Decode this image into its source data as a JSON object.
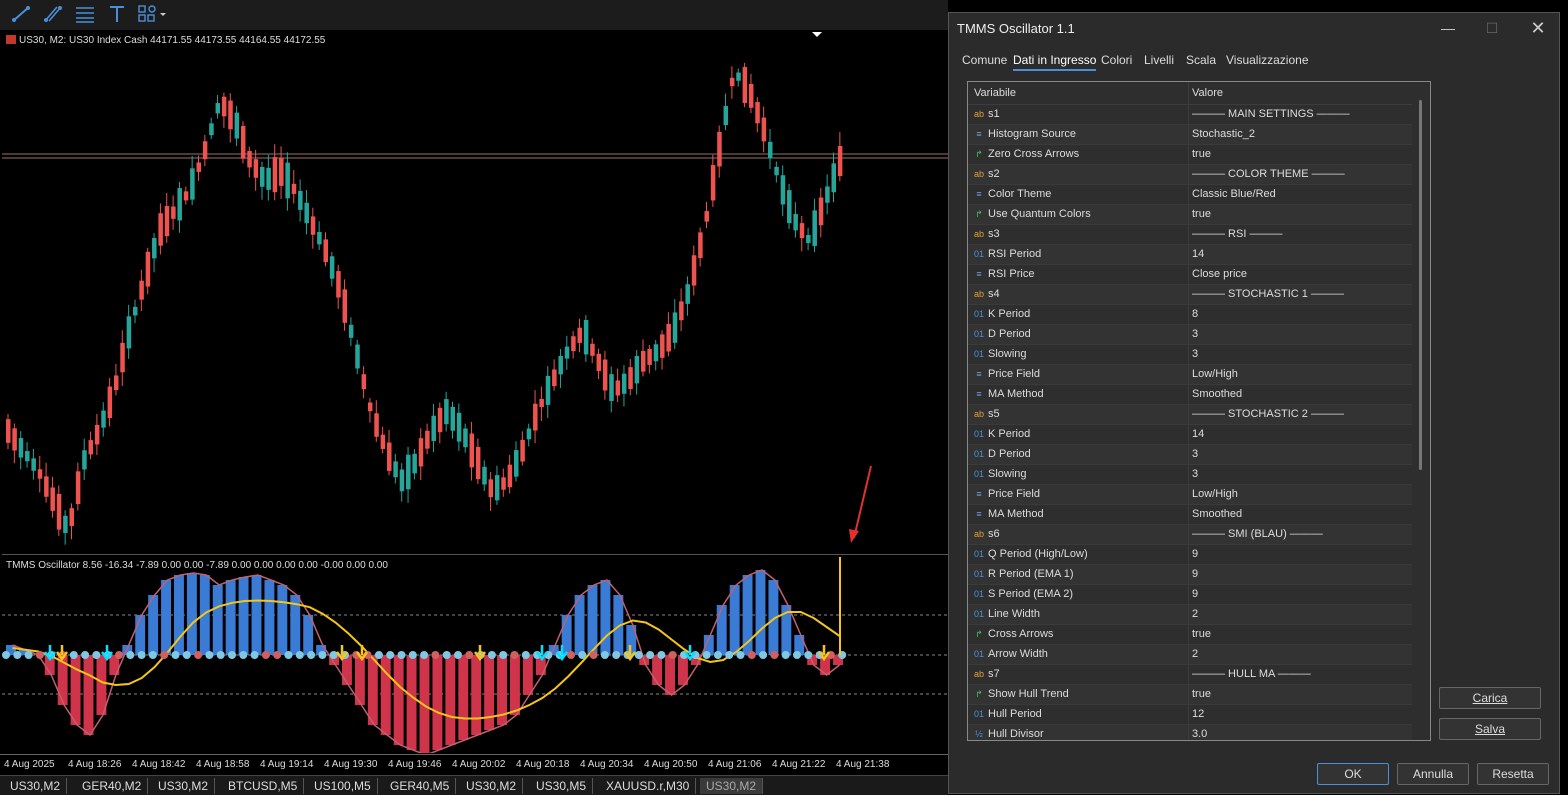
{
  "toolbar": {
    "icons": [
      "trendline-icon",
      "channel-icon",
      "fibonacci-icon",
      "text-icon",
      "shapes-icon"
    ]
  },
  "chart": {
    "info": "US30, M2:  US30 Index Cash  44171.55 44173.55 44164.55 44172.55",
    "osc_info": "TMMS Oscillator  8.56 -16.34 -7.89 0.00 0.00 -7.89 0.00 0.00 0.00 0.00 -0.00 0.00 0.00",
    "time_labels": [
      "4 Aug 2025",
      "4 Aug 18:26",
      "4 Aug 18:42",
      "4 Aug 18:58",
      "4 Aug 19:14",
      "4 Aug 19:30",
      "4 Aug 19:46",
      "4 Aug 20:02",
      "4 Aug 20:18",
      "4 Aug 20:34",
      "4 Aug 20:50",
      "4 Aug 21:06",
      "4 Aug 21:22",
      "4 Aug 21:38"
    ],
    "colors": {
      "bull": "#26a69a",
      "bear": "#ef5350",
      "hist_pos": "#3a7bd5",
      "hist_neg": "#d0344a",
      "ma_line": "#f5c518",
      "dots": "#7ec8e3"
    }
  },
  "symbol_tabs": [
    "US30,M2",
    "GER40,M2",
    "US30,M2",
    "BTCUSD,M5",
    "US100,M5",
    "GER40,M5",
    "US30,M2",
    "US30,M5",
    "XAUUSD.r,M30",
    "US30,M2"
  ],
  "dialog": {
    "title": "TMMS Oscillator  1.1",
    "tabs": [
      "Comune",
      "Dati in Ingresso",
      "Colori",
      "Livelli",
      "Scala",
      "Visualizzazione"
    ],
    "col_variable": "Variabile",
    "col_value": "Valore",
    "rows": [
      {
        "type": "ab",
        "name": "s1",
        "value": "——— MAIN SETTINGS ———"
      },
      {
        "type": "enum",
        "name": "Histogram Source",
        "value": "Stochastic_2"
      },
      {
        "type": "bool",
        "name": "Zero Cross Arrows",
        "value": "true"
      },
      {
        "type": "ab",
        "name": "s2",
        "value": "——— COLOR THEME ———"
      },
      {
        "type": "enum",
        "name": "Color Theme",
        "value": "Classic Blue/Red"
      },
      {
        "type": "bool",
        "name": "Use Quantum Colors",
        "value": "true"
      },
      {
        "type": "ab",
        "name": "s3",
        "value": "——— RSI ———"
      },
      {
        "type": "int",
        "name": "RSI Period",
        "value": "14"
      },
      {
        "type": "enum",
        "name": "RSI Price",
        "value": "Close price"
      },
      {
        "type": "ab",
        "name": "s4",
        "value": "——— STOCHASTIC 1 ———"
      },
      {
        "type": "int",
        "name": "K Period",
        "value": "8"
      },
      {
        "type": "int",
        "name": "D Period",
        "value": "3"
      },
      {
        "type": "int",
        "name": "Slowing",
        "value": "3"
      },
      {
        "type": "enum",
        "name": "Price Field",
        "value": "Low/High"
      },
      {
        "type": "enum",
        "name": "MA Method",
        "value": "Smoothed"
      },
      {
        "type": "ab",
        "name": "s5",
        "value": "——— STOCHASTIC 2 ———"
      },
      {
        "type": "int",
        "name": "K Period",
        "value": "14"
      },
      {
        "type": "int",
        "name": "D Period",
        "value": "3"
      },
      {
        "type": "int",
        "name": "Slowing",
        "value": "3"
      },
      {
        "type": "enum",
        "name": "Price Field",
        "value": "Low/High"
      },
      {
        "type": "enum",
        "name": "MA Method",
        "value": "Smoothed"
      },
      {
        "type": "ab",
        "name": "s6",
        "value": "——— SMI (BLAU) ———"
      },
      {
        "type": "int",
        "name": "Q Period (High/Low)",
        "value": "9"
      },
      {
        "type": "int",
        "name": "R Period (EMA 1)",
        "value": "9"
      },
      {
        "type": "int",
        "name": "S Period (EMA 2)",
        "value": "9"
      },
      {
        "type": "int",
        "name": "Line Width",
        "value": "2"
      },
      {
        "type": "bool",
        "name": "Cross Arrows",
        "value": "true"
      },
      {
        "type": "int",
        "name": "Arrow Width",
        "value": "2"
      },
      {
        "type": "ab",
        "name": "s7",
        "value": "——— HULL MA ———"
      },
      {
        "type": "bool",
        "name": "Show Hull Trend",
        "value": "true"
      },
      {
        "type": "int",
        "name": "Hull Period",
        "value": "12"
      },
      {
        "type": "frac",
        "name": "Hull Divisor",
        "value": "3.0"
      }
    ],
    "icon_glyphs": {
      "ab": "ab",
      "enum": "≡",
      "bool": "↱",
      "int": "01",
      "frac": "½"
    },
    "icon_colors": {
      "ab": "#e0a030",
      "enum": "#6fa0e0",
      "bool": "#3cc060",
      "int": "#4a90d9",
      "frac": "#4a90d9"
    },
    "btn_load": "Carica",
    "btn_save": "Salva",
    "btn_ok": "OK",
    "btn_cancel": "Annulla",
    "btn_reset": "Resetta"
  }
}
